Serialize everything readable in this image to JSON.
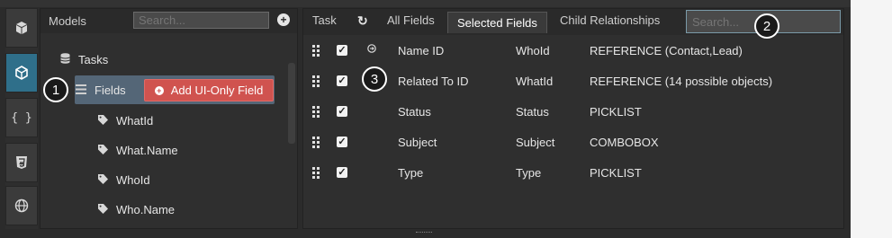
{
  "models_panel": {
    "title": "Models",
    "search_placeholder": "Search...",
    "tree": [
      {
        "label": "Tasks",
        "icon": "database-icon"
      },
      {
        "label": "Fields",
        "icon": "list-icon",
        "selected": true
      },
      {
        "label": "WhatId",
        "icon": "tag-icon"
      },
      {
        "label": "What.Name",
        "icon": "tag-icon"
      },
      {
        "label": "WhoId",
        "icon": "tag-icon"
      },
      {
        "label": "Who.Name",
        "icon": "tag-icon"
      }
    ],
    "add_button_label": "Add UI-Only Field"
  },
  "fields_panel": {
    "tabs": [
      {
        "label": "Task"
      },
      {
        "label": "All Fields"
      },
      {
        "label": "Selected Fields",
        "active": true
      },
      {
        "label": "Child Relationships"
      }
    ],
    "search_placeholder": "Search...",
    "rows": [
      {
        "label": "Name ID",
        "api": "WhoId",
        "type": "REFERENCE (Contact,Lead)",
        "checked": true,
        "icon": "arrow-circle-icon"
      },
      {
        "label": "Related To ID",
        "api": "WhatId",
        "type": "REFERENCE (14 possible objects)",
        "checked": true
      },
      {
        "label": "Status",
        "api": "Status",
        "type": "PICKLIST",
        "checked": true
      },
      {
        "label": "Subject",
        "api": "Subject",
        "type": "COMBOBOX",
        "checked": true
      },
      {
        "label": "Type",
        "api": "Type",
        "type": "PICKLIST",
        "checked": true
      }
    ]
  },
  "callouts": {
    "one": "1",
    "two": "2",
    "three": "3"
  },
  "icons": {
    "refresh": "↻",
    "plus": "+",
    "check": "✓"
  },
  "colors": {
    "accent": "#2f6f8a",
    "button": "#d0534f",
    "selection": "#546677"
  }
}
